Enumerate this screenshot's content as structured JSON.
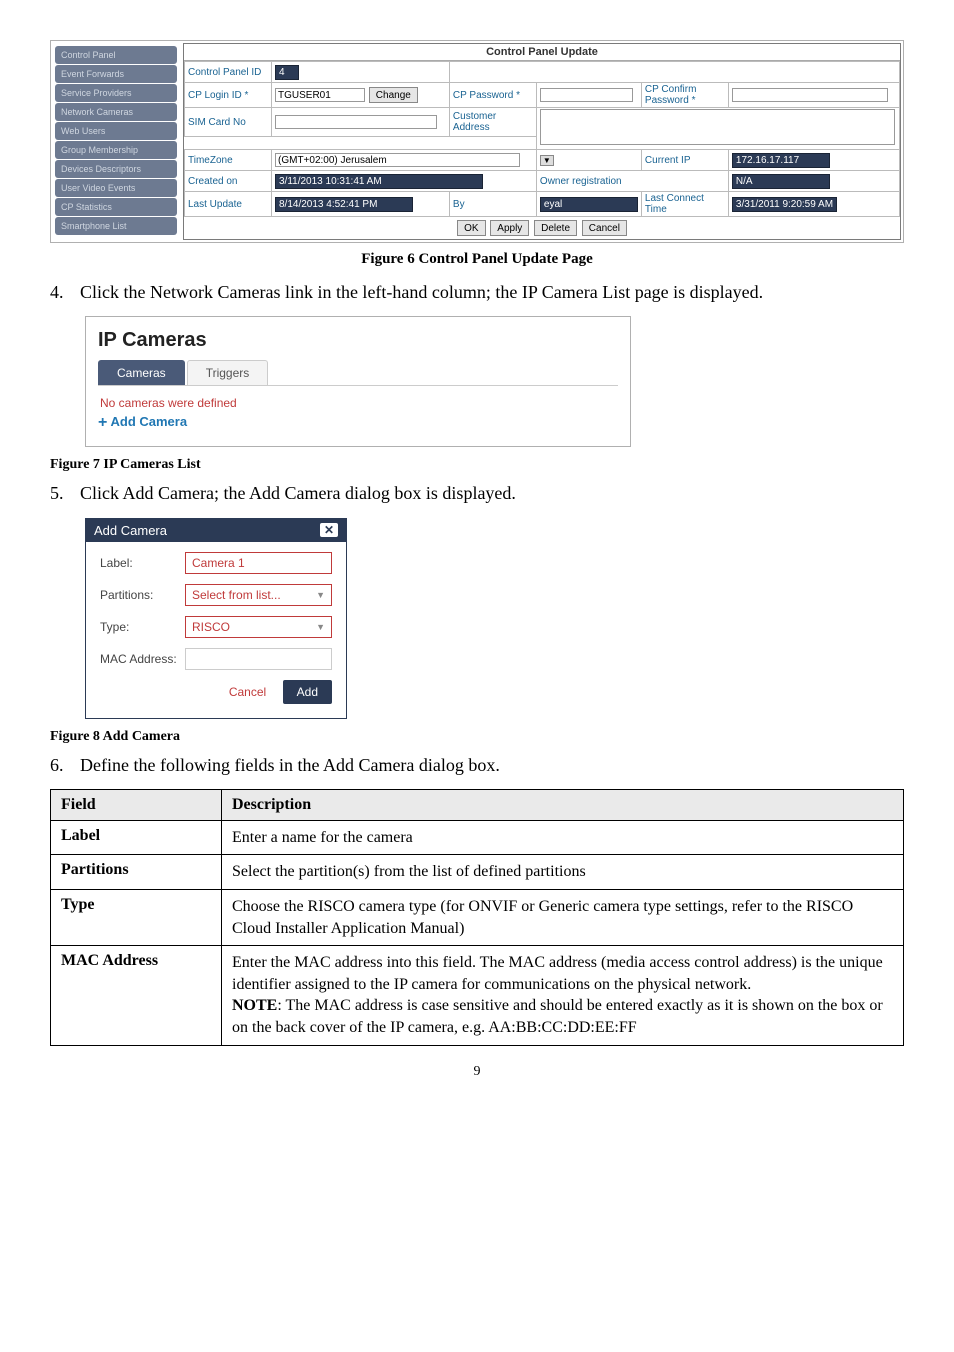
{
  "control_panel": {
    "title": "Control Panel Update",
    "sidebar": [
      "Control Panel",
      "Event Forwards",
      "Service Providers",
      "Network Cameras",
      "Web Users",
      "Group Membership",
      "Devices Descriptors",
      "User Video Events",
      "CP Statistics",
      "Smartphone List"
    ],
    "rows": {
      "control_panel_id_lbl": "Control Panel ID",
      "control_panel_id_val": "4",
      "cp_login_lbl": "CP Login ID *",
      "cp_login_val": "TGUSER01",
      "change_btn": "Change",
      "cp_password_lbl": "CP Password *",
      "cp_confirm_lbl": "CP Confirm Password *",
      "sim_lbl": "SIM Card No",
      "cust_addr_lbl": "Customer Address",
      "tz_lbl": "TimeZone",
      "tz_val": "(GMT+02:00) Jerusalem",
      "cur_ip_lbl": "Current IP",
      "cur_ip_val": "172.16.17.117",
      "created_lbl": "Created on",
      "created_val": "3/11/2013 10:31:41 AM",
      "owner_lbl": "Owner registration",
      "na": "N/A",
      "last_upd_lbl": "Last Update",
      "last_upd_val": "8/14/2013 4:52:41 PM",
      "by_lbl": "By",
      "by_val": "eyal",
      "last_conn_lbl": "Last Connect Time",
      "last_conn_val": "3/31/2011 9:20:59 AM"
    },
    "footer_btns": [
      "OK",
      "Apply",
      "Delete",
      "Cancel"
    ]
  },
  "fig6": "Figure 6 Control Panel Update Page",
  "step4_num": "4.",
  "step4_txt": "Click the Network Cameras link in the left-hand column; the IP Camera List page is displayed.",
  "ipc": {
    "title": "IP Cameras",
    "tab_cameras": "Cameras",
    "tab_triggers": "Triggers",
    "no_cams": "No cameras were defined",
    "add": "Add Camera"
  },
  "fig7": "Figure 7 IP Cameras List",
  "step5_num": "5.",
  "step5_txt": "Click Add Camera; the Add Camera dialog box is displayed.",
  "addcam": {
    "title": "Add Camera",
    "label_lbl": "Label:",
    "label_val": "Camera 1",
    "part_lbl": "Partitions:",
    "part_val": "Select from list...",
    "type_lbl": "Type:",
    "type_val": "RISCO",
    "mac_lbl": "MAC Address:",
    "cancel": "Cancel",
    "add": "Add"
  },
  "fig8": "Figure 8 Add Camera",
  "step6_num": "6.",
  "step6_txt": "Define the following fields in the Add Camera dialog box.",
  "table": {
    "h_field": "Field",
    "h_desc": "Description",
    "label_f": "Label",
    "label_d": "Enter a name for the camera",
    "part_f": "Partitions",
    "part_d": "Select the partition(s) from the list of defined partitions",
    "type_f": "Type",
    "type_d": "Choose the RISCO camera type (for ONVIF or Generic camera type settings, refer to the RISCO Cloud Installer Application Manual)",
    "mac_f": "MAC Address",
    "mac_d1": "Enter the MAC address into this field. The MAC address (media access control address) is the unique identifier assigned to the IP camera for communications on the physical network.",
    "mac_note_b": "NOTE",
    "mac_d2": ": The MAC address is case sensitive and should be entered exactly as it is shown on the box or on the back cover of the IP camera, e.g. AA:BB:CC:DD:EE:FF"
  },
  "page": "9"
}
